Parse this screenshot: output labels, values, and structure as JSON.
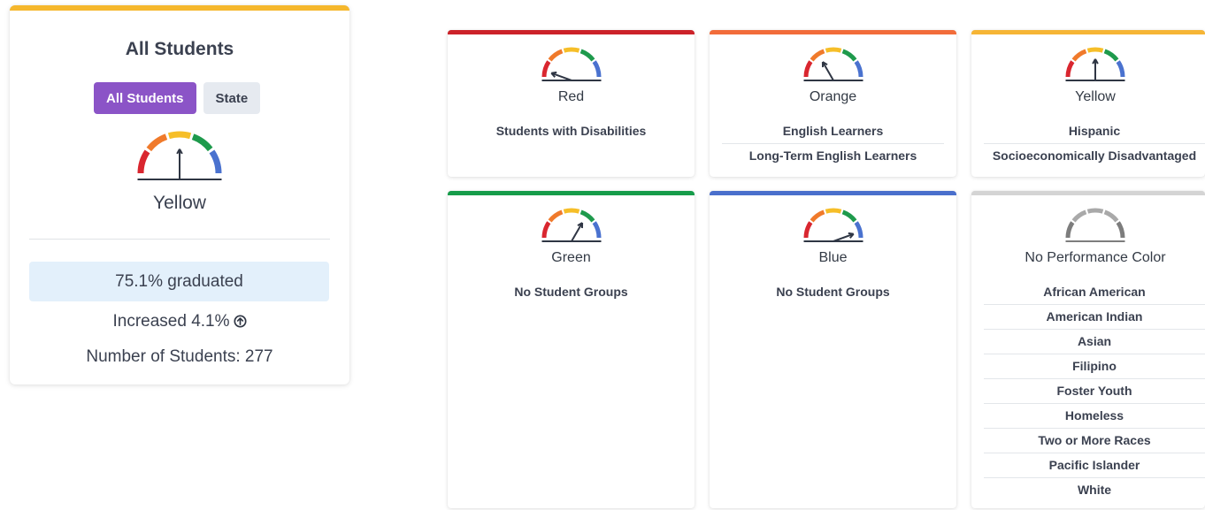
{
  "summary": {
    "title": "All Students",
    "toggle": {
      "active": "All Students",
      "inactive": "State"
    },
    "color_label": "Yellow",
    "rate_text": "75.1% graduated",
    "change_text": "Increased 4.1%",
    "students_text": "Number of Students: 277",
    "accent_color": "#f5b72c",
    "toggle_active_color": "#8b54c7",
    "rate_bg": "#e3f0fb"
  },
  "gauge_colors": {
    "red": "#d9262f",
    "orange": "#f07a2b",
    "yellow": "#f6be28",
    "green": "#1e9a4c",
    "blue": "#4a72cf",
    "needle": "#2f3644",
    "gray": "#7d7d7d",
    "lightgray": "#a9a9a9"
  },
  "cards": [
    {
      "color_name": "Red",
      "border": "#cc2229",
      "level": "red",
      "groups": [
        "Students with Disabilities"
      ]
    },
    {
      "color_name": "Orange",
      "border": "#f26c3a",
      "level": "orange",
      "groups": [
        "English Learners",
        "Long-Term English Learners"
      ]
    },
    {
      "color_name": "Yellow",
      "border": "#f6b535",
      "level": "yellow",
      "groups": [
        "Hispanic",
        "Socioeconomically Disadvantaged"
      ]
    },
    {
      "color_name": "Green",
      "border": "#169c4a",
      "level": "green",
      "groups": [
        "No Student Groups"
      ]
    },
    {
      "color_name": "Blue",
      "border": "#4a6fcc",
      "level": "blue",
      "groups": [
        "No Student Groups"
      ]
    },
    {
      "color_name": "No Performance Color",
      "border": "#d4d4d4",
      "level": "none",
      "groups": [
        "African American",
        "American Indian",
        "Asian",
        "Filipino",
        "Foster Youth",
        "Homeless",
        "Two or More Races",
        "Pacific Islander",
        "White"
      ]
    }
  ]
}
